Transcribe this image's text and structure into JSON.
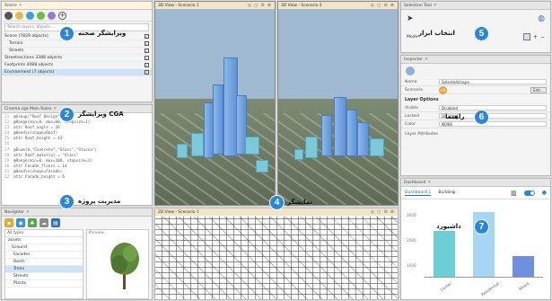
{
  "scene_panel": {
    "title": "Scene",
    "filter_text": "Search layers, objects ...",
    "rows": [
      "Scene (7829 objects)",
      "Terrain",
      "Streets",
      "Streetsections 3388 objects",
      "Footprints 4088 objects",
      "Environment (7 objects)"
    ],
    "label": "ویرایشگر صحنه"
  },
  "cga_panel": {
    "title": "Cinema.cga Main Rules",
    "lines": [
      "@Group(\"Roof Design\", 2)",
      "@Range(min=0, max=60, stepsize=1)",
      "attr Roof_angle = 26",
      "@Handle(shape=Roof)",
      "attr Roof_height = 43",
      "",
      "@Enum(0,\"Concrete\",\"Glass\",\"Stucco\")",
      "attr Roof_material = \"Glass\"",
      "@Range(min=0, max=100, stepsize=1)",
      "attr Facade_floors = 14",
      "@Handle(shape=Facade)",
      "attr Facade_height = 6"
    ],
    "label": "ویرایشگر CGA"
  },
  "navigator": {
    "title": "Navigator",
    "search": "All types",
    "tree": [
      "assets",
      "Ground",
      "Facades",
      "Roofs",
      "Trees",
      "Streets",
      "Plants"
    ],
    "preview_title": "Preview",
    "label": "مدیریت پروژه"
  },
  "viewports": {
    "left_title": "3D View - Scenario 1",
    "right_title": "3D View - Scenario 2",
    "bottom_title": "2D View - Scenario 1",
    "toolbar": "◎ ▢ ☰ ⚙",
    "label": "نمایشگر"
  },
  "selection_tool": {
    "title": "Selection Tool",
    "mode_label": "Mode",
    "label": "انتخاب ابزار"
  },
  "inspector": {
    "title": "Inspector",
    "name_label": "Name",
    "name_value": "Selectedshape",
    "scenario_label": "Scenario",
    "scenario_value": "All",
    "edit_button": "Edit...",
    "section": "Layer Options",
    "options": [
      {
        "key": "Visible",
        "value": "Disabled"
      },
      {
        "key": "Locked",
        "value": "Disabled"
      },
      {
        "key": "Color",
        "value": "NONE"
      }
    ],
    "footer": "Layer Attributes",
    "label": "راهنما"
  },
  "dashboard": {
    "title": "Dashboard",
    "tab1": "Dashboard 1",
    "tab2": "Building",
    "label": "داشبورد",
    "chart_data": {
      "type": "bar",
      "categories": [
        "Center",
        "Residential",
        "Mixed"
      ],
      "values": [
        2200,
        3100,
        1000
      ],
      "ylabel": "",
      "ylim": [
        0,
        3300
      ],
      "yticks": [
        "3000",
        "2000",
        "1000"
      ],
      "colors": [
        "#6dcfd6",
        "#a7d6f4",
        "#6f8fdf"
      ]
    }
  },
  "markers": [
    "1",
    "2",
    "3",
    "4",
    "5",
    "6",
    "7"
  ]
}
